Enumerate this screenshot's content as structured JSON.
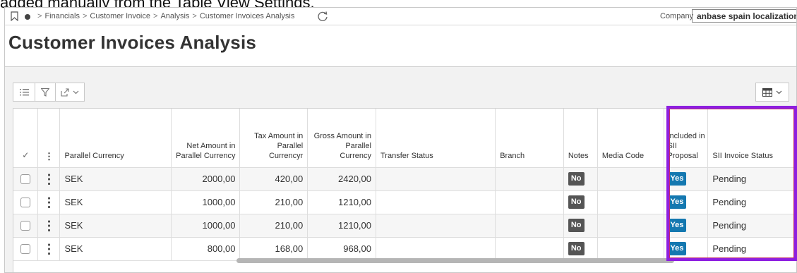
{
  "caption": "added manually from the Table View Settings.",
  "navbar": {
    "breadcrumb": [
      "Financials",
      "Customer Invoice",
      "Analysis",
      "Customer Invoices Analysis"
    ],
    "company_label": "Company",
    "company_value": "anbase spain localization"
  },
  "page": {
    "title": "Customer Invoices Analysis"
  },
  "icons": {
    "bookmark": "bookmark-icon",
    "navigator": "navigator-dot-icon",
    "refresh": "refresh-icon",
    "details": "details-list-icon",
    "filter": "filter-icon",
    "export": "export-icon",
    "table_view": "table-view-icon"
  },
  "table": {
    "columns": [
      "Parallel Currency",
      "Net Amount in Parallel Currency",
      "Tax Amount in Parallel Currencyr",
      "Gross Amount in Parallel Currency",
      "Transfer Status",
      "Branch",
      "Notes",
      "Media Code",
      "Included in SII Proposal",
      "SII Invoice Status"
    ],
    "rows": [
      {
        "currency": "SEK",
        "net": "2000,00",
        "tax": "420,00",
        "gross": "2420,00",
        "transfer_status": "",
        "branch": "",
        "notes": "No",
        "media_code": "",
        "included": "Yes",
        "sii_status": "Pending"
      },
      {
        "currency": "SEK",
        "net": "1000,00",
        "tax": "210,00",
        "gross": "1210,00",
        "transfer_status": "",
        "branch": "",
        "notes": "No",
        "media_code": "",
        "included": "Yes",
        "sii_status": "Pending"
      },
      {
        "currency": "SEK",
        "net": "1000,00",
        "tax": "210,00",
        "gross": "1210,00",
        "transfer_status": "",
        "branch": "",
        "notes": "No",
        "media_code": "",
        "included": "Yes",
        "sii_status": "Pending"
      },
      {
        "currency": "SEK",
        "net": "800,00",
        "tax": "168,00",
        "gross": "968,00",
        "transfer_status": "",
        "branch": "",
        "notes": "No",
        "media_code": "",
        "included": "Yes",
        "sii_status": "Pending"
      }
    ]
  },
  "colors": {
    "highlight_border": "#8e1fe0",
    "badge_yes": "#1478b0",
    "badge_no": "#555555"
  }
}
